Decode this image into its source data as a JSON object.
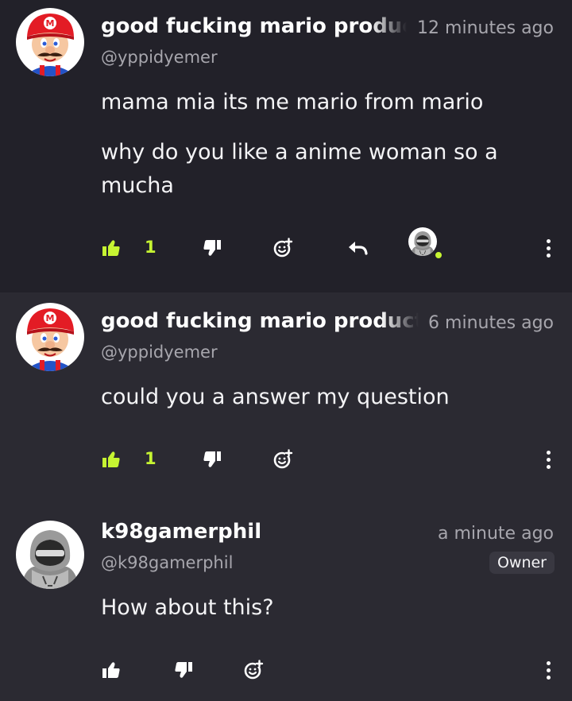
{
  "colors": {
    "accent": "#c6f432",
    "text_secondary": "#a7a6ad"
  },
  "comments": [
    {
      "author": "good fucking mario product",
      "time": "12 minutes ago",
      "handle": "@yppidyemer",
      "body": [
        "mama mia its me mario from mario",
        "why do you like a anime woman so a mucha"
      ],
      "likes": "1",
      "liked": true,
      "avatar": "mario-avatar-icon"
    },
    {
      "author": "good fucking mario producti",
      "time": "6 minutes ago",
      "handle": "@yppidyemer",
      "body": [
        "could you a answer my question"
      ],
      "likes": "1",
      "liked": true,
      "avatar": "mario-avatar-icon"
    },
    {
      "author": "k98gamerphil",
      "time": "a minute ago",
      "handle": "@k98gamerphil",
      "body": [
        "How about this?"
      ],
      "badge": "Owner",
      "liked": false,
      "avatar": "hooded-figure-avatar-icon"
    }
  ]
}
